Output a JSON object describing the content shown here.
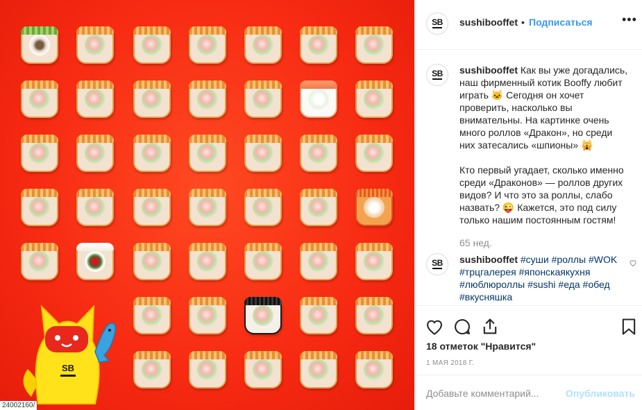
{
  "post": {
    "username": "sushibooffet",
    "follow_label": "Подписаться",
    "dot": "•",
    "avatar_text": "SB",
    "photo_label": "24002160/"
  },
  "comments": [
    {
      "username": "sushibooffet",
      "text": "Как вы уже догадались, наш фирменный котик Booffy любит играть 🐱 Сегодня он хочет проверить, насколько вы внимательны. На картинке очень много роллов «Дракон», но среди них затесались «шпионы» 🙀\n\nКто первый угадает, сколько именно среди «Драконов» — роллов других видов? И что это за роллы, слабо назвать? 😜 Кажется, это под силу только нашим постоянным гостям!",
      "time": "65 нед."
    },
    {
      "username": "sushibooffet",
      "hashtags": "#суши #роллы #WOK #трцгалерея #японскаякухня #люблюроллы #sushi #еда #обед #вкусняшка"
    }
  ],
  "actions": {
    "likes": "18 отметок \"Нравится\"",
    "date": "1 МАЯ 2018 Г."
  },
  "comment_box": {
    "placeholder": "Добавьте комментарий...",
    "publish_label": "Опубликовать"
  },
  "icons": {
    "like": "heart-icon",
    "comment": "comment-icon",
    "share": "share-icon",
    "save": "bookmark-icon",
    "more": "more-icon",
    "comment_like": "small-heart-icon"
  },
  "colors": {
    "link": "#3897f0",
    "publish_disabled": "#b2dffc",
    "photo_bg": "#f72a12"
  },
  "photo_grid": {
    "rows": [
      [
        "green",
        "dragon",
        "dragon",
        "dragon",
        "dragon",
        "dragon",
        "dragon"
      ],
      [
        "dragon",
        "dragon",
        "dragon",
        "dragon",
        "dragon",
        "white",
        "dragon"
      ],
      [
        "dragon",
        "dragon",
        "dragon",
        "dragon",
        "dragon",
        "dragon",
        "dragon"
      ],
      [
        "dragon",
        "dragon",
        "dragon",
        "dragon",
        "dragon",
        "dragon",
        "spicy"
      ],
      [
        "dragon",
        "cucumber",
        "dragon",
        "dragon",
        "dragon",
        "dragon",
        "dragon"
      ],
      [
        "",
        "",
        "dragon",
        "dragon",
        "nori",
        "dragon",
        "dragon"
      ],
      [
        "",
        "",
        "dragon",
        "dragon",
        "dragon",
        "dragon",
        "dragon"
      ]
    ]
  }
}
